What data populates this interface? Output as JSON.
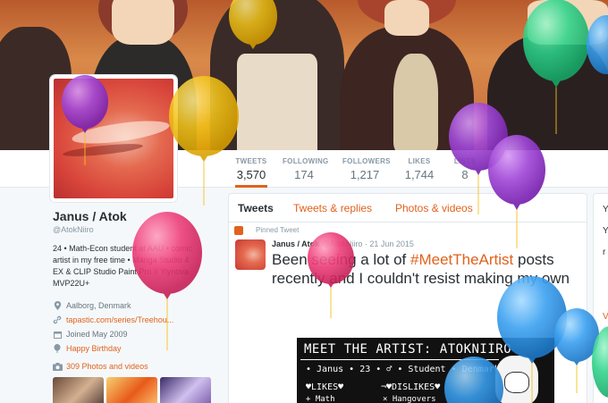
{
  "profile": {
    "name": "Janus / Atok",
    "handle": "@AtokNiiro",
    "bio_line1": "24 • Math-Econ student at AAU • comic",
    "bio_line2": "artist in my free time • Manga Studio 4",
    "bio_line3": "EX & CLIP Studio Paint Pro // Yiynova",
    "bio_line4": "MVP22U+",
    "location": "Aalborg, Denmark",
    "website": "tapastic.com/series/Treehou...",
    "joined": "Joined May 2009",
    "birthday": "Happy Birthday",
    "photos_label": "309 Photos and videos"
  },
  "stats": {
    "tweets_label": "TWEETS",
    "tweets_value": "3,570",
    "following_label": "FOLLOWING",
    "following_value": "174",
    "followers_label": "FOLLOWERS",
    "followers_value": "1,217",
    "likes_label": "LIKES",
    "likes_value": "1,744",
    "lists_label": "LISTS",
    "lists_value": "8"
  },
  "timeline": {
    "tabs": [
      "Tweets",
      "Tweets & replies",
      "Photos & videos"
    ],
    "pinned_label": "Pinned Tweet",
    "tweet_name": "Janus / Atok",
    "tweet_handle": "@AtokNiiro",
    "tweet_date": "21 Jun 2015",
    "tweet_text_before": "Been seeing a lot of ",
    "tweet_hashtag": "#MeetTheArtist",
    "tweet_text_after": " posts recently and I couldn't resist making my own"
  },
  "meet_image": {
    "title": "MEET THE ARTIST: ATOKNIIRO",
    "info": "• Janus • 23 • ♂ • Student • Denmark •",
    "likes": "♥LIKES♥",
    "dislikes": "¬♥DISLIKES♥",
    "likes_item": "+ Math",
    "dislikes_item": "× Hangovers"
  },
  "rightcol": {
    "letters": [
      "Y",
      "Y",
      "r",
      "V"
    ]
  },
  "colors": {
    "accent": "#e0621d",
    "balloon_purple": "#9b3fd1",
    "balloon_yellow": "#f2c318",
    "balloon_pink": "#ee3f7a",
    "balloon_blue": "#3aa0f0",
    "balloon_green": "#2dd38a"
  }
}
